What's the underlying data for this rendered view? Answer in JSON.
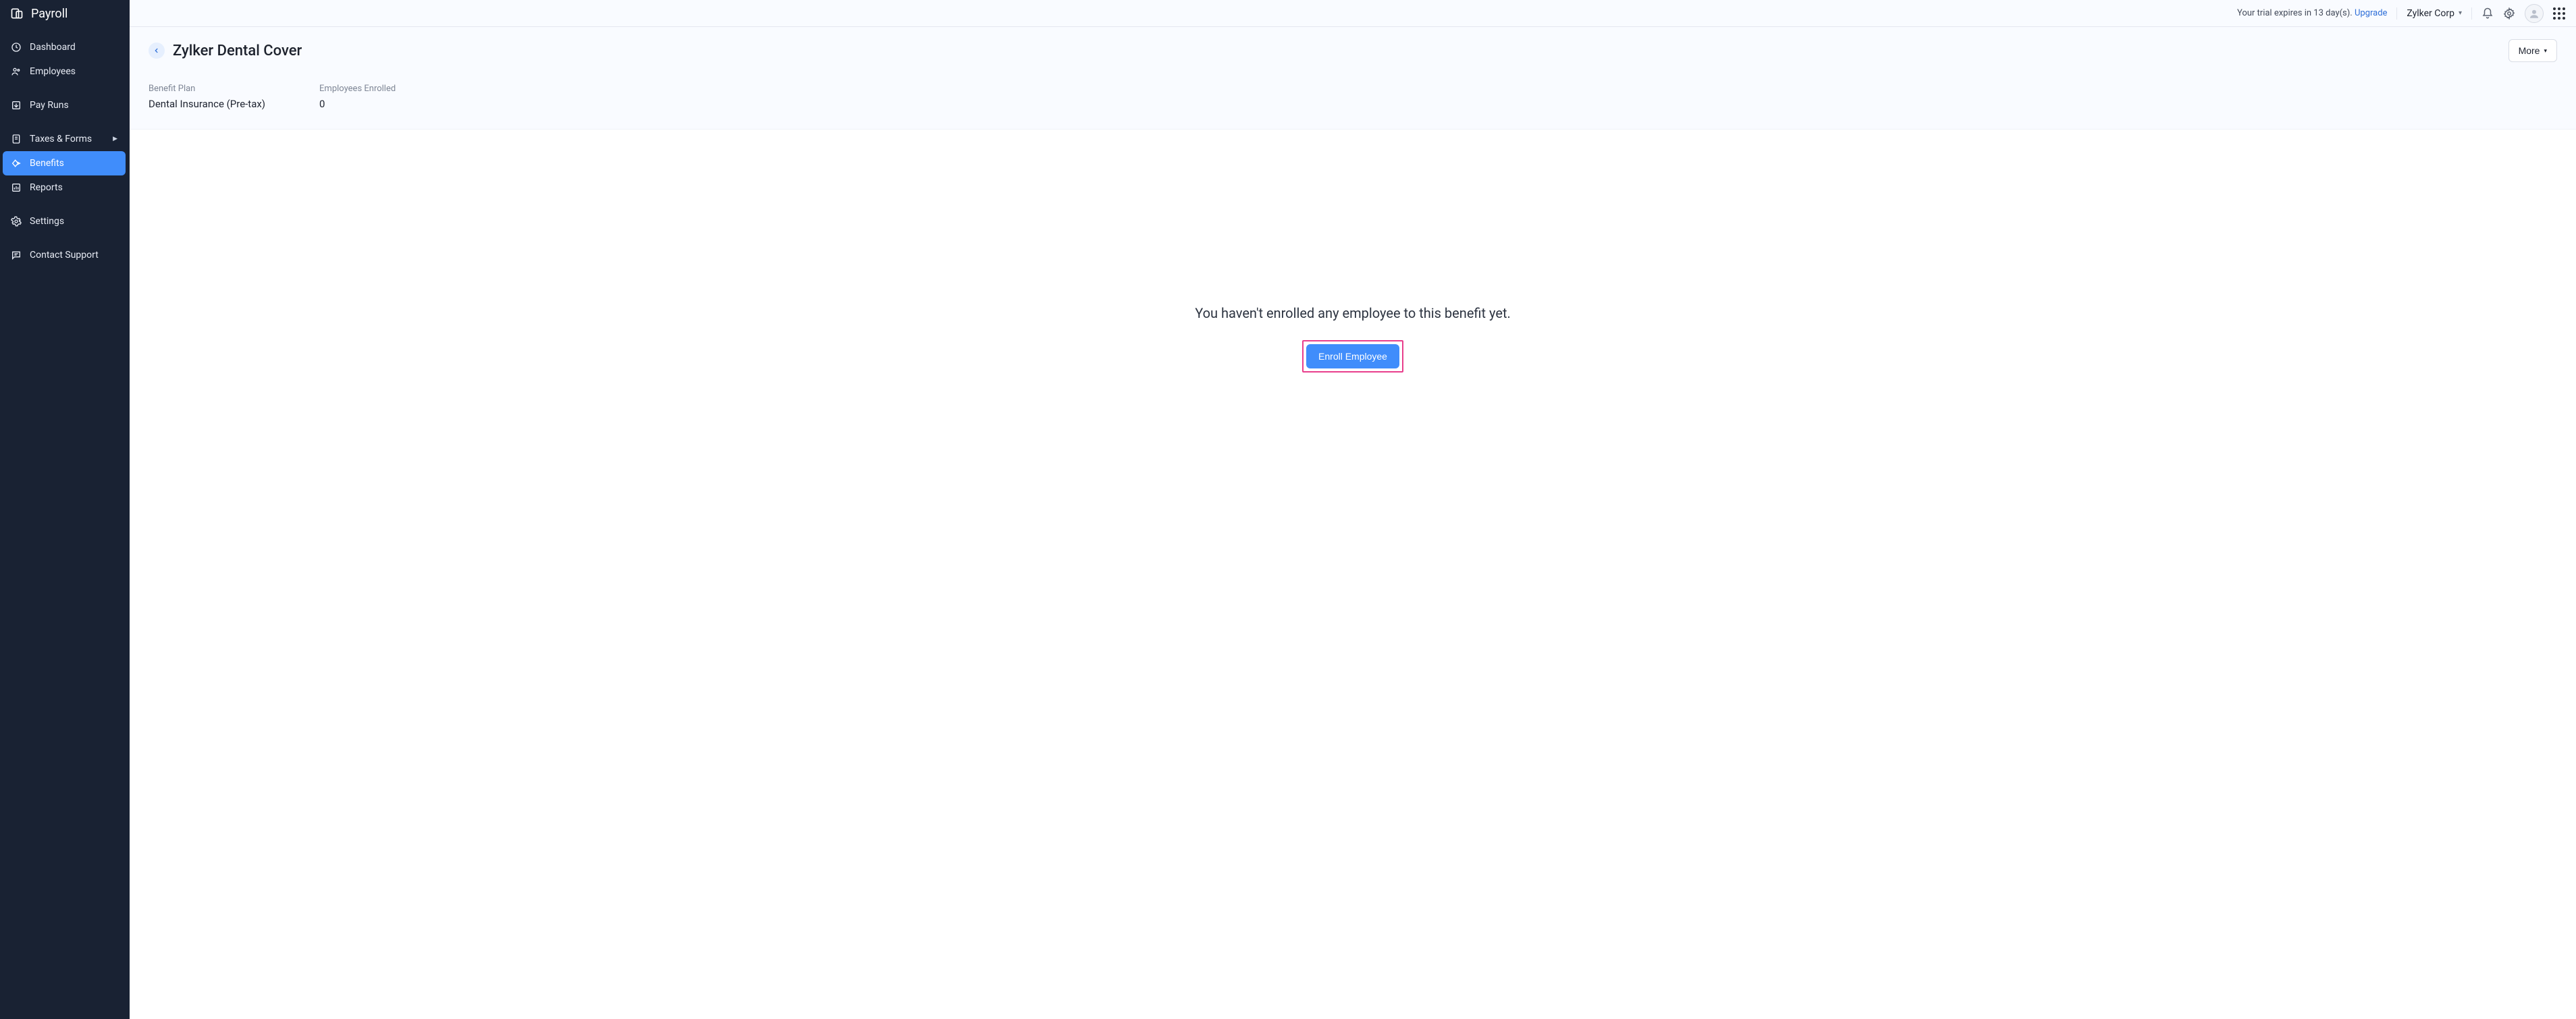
{
  "app": {
    "name": "Payroll"
  },
  "sidebar": {
    "items": [
      {
        "id": "dashboard",
        "label": "Dashboard",
        "active": false,
        "hasSubmenu": false
      },
      {
        "id": "employees",
        "label": "Employees",
        "active": false,
        "hasSubmenu": false
      },
      {
        "id": "payruns",
        "label": "Pay Runs",
        "active": false,
        "hasSubmenu": false
      },
      {
        "id": "taxes",
        "label": "Taxes & Forms",
        "active": false,
        "hasSubmenu": true
      },
      {
        "id": "benefits",
        "label": "Benefits",
        "active": true,
        "hasSubmenu": false
      },
      {
        "id": "reports",
        "label": "Reports",
        "active": false,
        "hasSubmenu": false
      },
      {
        "id": "settings",
        "label": "Settings",
        "active": false,
        "hasSubmenu": false
      },
      {
        "id": "support",
        "label": "Contact Support",
        "active": false,
        "hasSubmenu": false
      }
    ]
  },
  "topbar": {
    "trial_text": "Your trial expires in 13 day(s). ",
    "upgrade_label": "Upgrade",
    "org_name": "Zylker Corp"
  },
  "page": {
    "title": "Zylker Dental Cover",
    "more_label": "More",
    "summary": {
      "plan_label": "Benefit Plan",
      "plan_value": "Dental Insurance (Pre-tax)",
      "enrolled_label": "Employees Enrolled",
      "enrolled_value": "0"
    },
    "empty": {
      "message": "You haven't enrolled any employee to this benefit yet.",
      "button": "Enroll Employee"
    }
  }
}
